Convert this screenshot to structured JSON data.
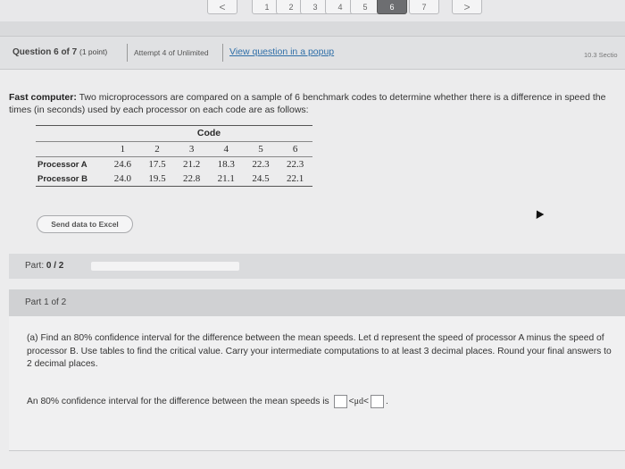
{
  "pager": {
    "prev": "<",
    "pages": [
      "1",
      "2",
      "3",
      "4",
      "5",
      "6",
      "7"
    ],
    "current": "6",
    "next": ">"
  },
  "header": {
    "question": "Question 6 of 7",
    "points": "(1 point)",
    "attempt": "Attempt 4 of Unlimited",
    "popup_link": "View question in a popup",
    "section": "10.3 Sectio"
  },
  "problem": {
    "lead": "Fast computer:",
    "text": "Two microprocessors are compared on a sample of 6 benchmark codes to determine whether there is a difference in speed the times (in seconds) used by each processor on each code are as follows:"
  },
  "table": {
    "code_header": "Code",
    "codes": [
      "1",
      "2",
      "3",
      "4",
      "5",
      "6"
    ],
    "rows": [
      {
        "label": "Processor A",
        "values": [
          "24.6",
          "17.5",
          "21.2",
          "18.3",
          "22.3",
          "22.3"
        ]
      },
      {
        "label": "Processor B",
        "values": [
          "24.0",
          "19.5",
          "22.8",
          "21.1",
          "24.5",
          "22.1"
        ]
      }
    ]
  },
  "excel_button": "Send data to Excel",
  "part": {
    "label": "Part:",
    "value": "0 / 2",
    "progress_fraction": 0
  },
  "part1": {
    "title": "Part 1 of 2",
    "question": "(a) Find an 80% confidence interval for the difference between the mean speeds. Let d represent the speed of processor A minus the speed of processor B. Use tables to find the critical value. Carry your intermediate computations to at least 3 decimal places. Round your final answers to 2 decimal places.",
    "answer_prefix": "An 80% confidence interval for the difference between the mean speeds is",
    "lt1": "<",
    "mu": "μd",
    "lt2": "<",
    "period": "."
  }
}
